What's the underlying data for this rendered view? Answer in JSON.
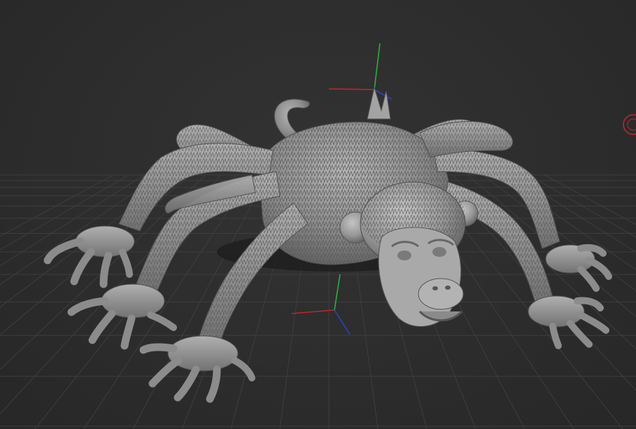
{
  "app": {
    "view": "3d-sculpt-viewport"
  },
  "viewport": {
    "background_color": "#2b2b2b",
    "grid_color": "#3e3e3e",
    "model_color": "#9a9a9a",
    "model": {
      "name": "monkey-spider-sculpt-mesh",
      "parts": [
        "head",
        "body",
        "tail",
        "leg",
        "leg",
        "leg",
        "leg",
        "leg",
        "leg",
        "leg",
        "leg"
      ]
    },
    "axes": {
      "x_color": "#c0262a",
      "y_color": "#2fae3a",
      "z_color": "#3040c0"
    },
    "gizmos": [
      "origin-axis-gizmo",
      "pivot-axis-gizmo",
      "rotate-gizmo-handle"
    ]
  }
}
